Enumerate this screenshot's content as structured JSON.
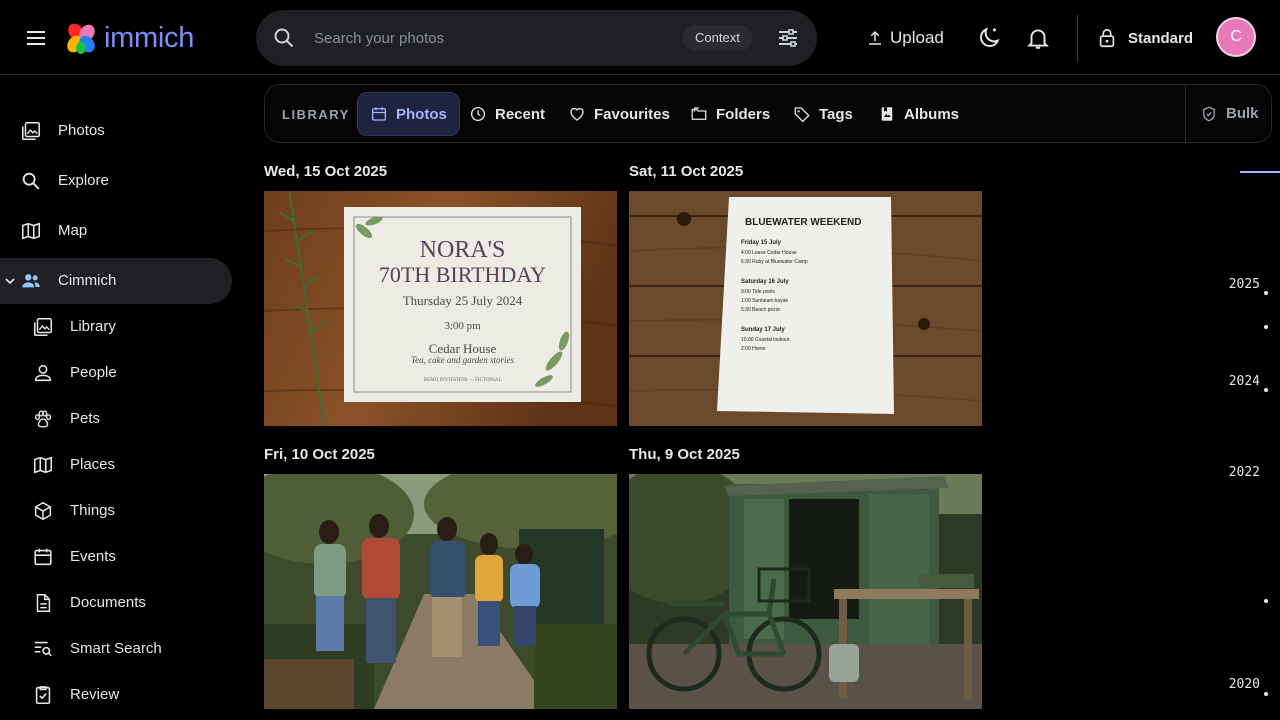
{
  "app": {
    "name": "immich"
  },
  "search": {
    "placeholder": "Search your photos",
    "context_chip": "Context"
  },
  "topbar": {
    "upload_label": "Upload",
    "lock_label": "Standard",
    "avatar_initial": "C"
  },
  "sidebar": {
    "items": [
      {
        "label": "Photos",
        "icon": "photos-icon"
      },
      {
        "label": "Explore",
        "icon": "search-icon"
      },
      {
        "label": "Map",
        "icon": "map-icon"
      },
      {
        "label": "Cimmich",
        "icon": "people-icon",
        "expanded": true
      },
      {
        "label": "Library",
        "icon": "library-icon"
      },
      {
        "label": "People",
        "icon": "person-icon"
      },
      {
        "label": "Pets",
        "icon": "paw-icon"
      },
      {
        "label": "Places",
        "icon": "map-icon"
      },
      {
        "label": "Things",
        "icon": "cube-icon"
      },
      {
        "label": "Events",
        "icon": "calendar-icon"
      },
      {
        "label": "Documents",
        "icon": "document-icon"
      },
      {
        "label": "Smart Search",
        "icon": "smart-search-icon"
      },
      {
        "label": "Review",
        "icon": "review-icon"
      }
    ]
  },
  "library_bar": {
    "section_label": "LIBRARY",
    "tabs": [
      "Photos",
      "Recent",
      "Favourites",
      "Folders",
      "Tags",
      "Albums"
    ],
    "bulk_label": "Bulk"
  },
  "timeline": {
    "groups": [
      {
        "date": "Wed, 15 Oct 2025",
        "photo": "birthday-invitation-card"
      },
      {
        "date": "Sat, 11 Oct 2025",
        "photo": "weekend-itinerary-sheet"
      },
      {
        "date": "Fri, 10 Oct 2025",
        "photo": "family-walking-garden"
      },
      {
        "date": "Thu, 9 Oct 2025",
        "photo": "bicycle-by-shed"
      }
    ],
    "card1": {
      "title1": "NORA'S",
      "title2": "70TH BIRTHDAY",
      "date": "Thursday 25 July 2024",
      "time": "3:00 pm",
      "venue": "Cedar House",
      "note": "Tea, cake and garden stories",
      "footer": "DEMO INVITATION — FICTIONAL"
    },
    "card2": {
      "title": "BLUEWATER WEEKEND",
      "days": [
        {
          "day": "Friday 15 July",
          "items": [
            "4:00  Leave Cedar House",
            "6:30  Ruby at Bluewater Camp"
          ]
        },
        {
          "day": "Saturday 16 July",
          "items": [
            "9:00  Tide pools",
            "1:00  Sunbeam kayak",
            "5:30  Beach picnic"
          ]
        },
        {
          "day": "Sunday 17 July",
          "items": [
            "10:00  Coastal lookout",
            "2:00  Home"
          ]
        }
      ]
    }
  },
  "scrubber": {
    "years": [
      "2025",
      "2024",
      "2022",
      "2020"
    ]
  },
  "colors": {
    "accent": "#a5b4fc",
    "background": "#000000",
    "avatar": "#e879b9"
  }
}
